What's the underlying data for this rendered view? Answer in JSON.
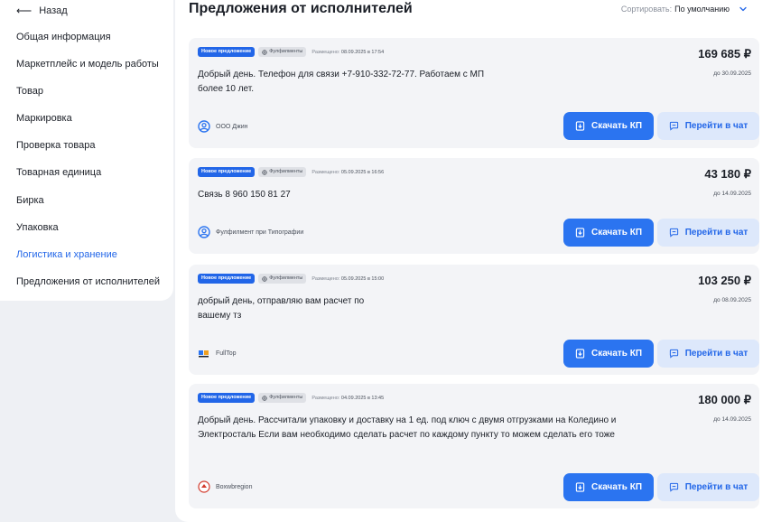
{
  "sidebar": {
    "back_label": "Назад",
    "items": [
      {
        "label": "Общая информация",
        "active": false
      },
      {
        "label": "Маркетплейс и модель работы",
        "active": false
      },
      {
        "label": "Товар",
        "active": false
      },
      {
        "label": "Маркировка",
        "active": false
      },
      {
        "label": "Проверка товара",
        "active": false
      },
      {
        "label": "Товарная единица",
        "active": false
      },
      {
        "label": "Бирка",
        "active": false
      },
      {
        "label": "Упаковка",
        "active": false
      },
      {
        "label": "Логистика и хранение",
        "active": true
      },
      {
        "label": "Предложения от исполнителей",
        "active": false
      }
    ]
  },
  "main": {
    "title": "Предложения от исполнителей",
    "sort_label": "Сортировать:",
    "sort_value": "По умолчанию",
    "buttons": {
      "download": "Скачать КП",
      "chat": "Перейти в чат"
    },
    "offers": [
      {
        "badge_new": "Новое предложение",
        "badge_category": "Фулфилменты",
        "posted_label": "Размещено:",
        "posted_value": "08.09.2025 в 17:54",
        "price": "169 685 ₽",
        "deadline": "до 30.09.2025",
        "message": "Добрый день. Телефон для связи +7-910-332-72-77. Работаем с МП более 10 лет.",
        "company": "ООО Джин",
        "company_icon": "user-icon"
      },
      {
        "badge_new": "Новое предложение",
        "badge_category": "Фулфилменты",
        "posted_label": "Размещено:",
        "posted_value": "05.09.2025 в 16:56",
        "price": "43 180 ₽",
        "deadline": "до 14.09.2025",
        "message": "Связь 8 960 150 81 27",
        "company": "Фулфилмент при Типографии",
        "company_icon": "user-icon"
      },
      {
        "badge_new": "Новое предложение",
        "badge_category": "Фулфилменты",
        "posted_label": "Размещено:",
        "posted_value": "05.09.2025 в 15:00",
        "price": "103 250 ₽",
        "deadline": "до 08.09.2025",
        "message": "добрый день, отправляю вам расчет по вашему тз",
        "company": "FullTop",
        "company_icon": "fulltop-logo"
      },
      {
        "badge_new": "Новое предложение",
        "badge_category": "Фулфилменты",
        "posted_label": "Размещено:",
        "posted_value": "04.09.2025 в 13:45",
        "price": "180 000 ₽",
        "deadline": "до 14.09.2025",
        "message": "Добрый день. Рассчитали упаковку и доставку на 1 ед. под ключ с двумя отгрузками на Коледино и Электросталь Если вам необходимо сделать расчет по каждому пункту то можем сделать его тоже",
        "company": "Boxwbregion",
        "company_icon": "boxwbregion-logo"
      }
    ]
  },
  "colors": {
    "accent": "#2266e8",
    "button_primary": "#2b74f0",
    "button_secondary_bg": "#dde8fb",
    "card_bg": "#f3f4f7",
    "page_bg": "#eef0f4"
  }
}
